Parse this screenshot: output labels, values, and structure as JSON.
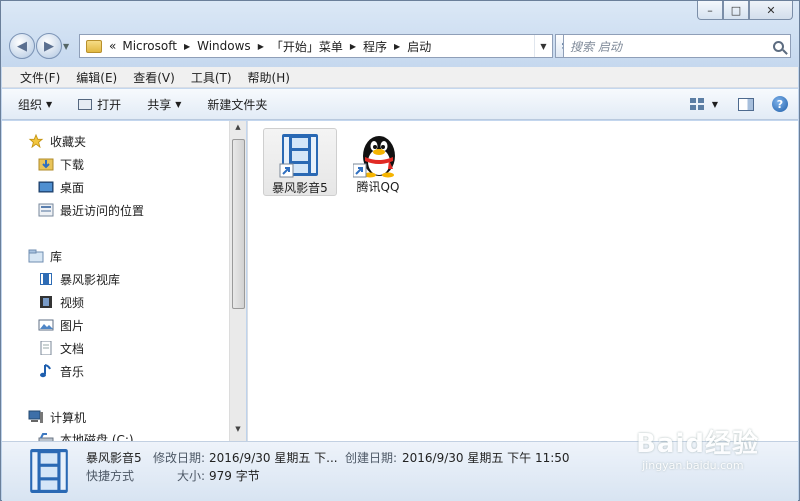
{
  "window": {
    "caption_buttons": {
      "minimize": "–",
      "maximize": "□",
      "close": "✕"
    }
  },
  "address": {
    "crumbs": [
      "«",
      "Microsoft",
      "Windows",
      "「开始」菜单",
      "程序",
      "启动"
    ],
    "search_placeholder": "搜索 启动"
  },
  "menu": [
    "文件(F)",
    "编辑(E)",
    "查看(V)",
    "工具(T)",
    "帮助(H)"
  ],
  "toolbar": {
    "organize": "组织",
    "open": "打开",
    "share": "共享",
    "new_folder": "新建文件夹"
  },
  "nav": {
    "favorites": {
      "label": "收藏夹",
      "items": [
        "下载",
        "桌面",
        "最近访问的位置"
      ]
    },
    "libraries": {
      "label": "库",
      "items": [
        "暴风影视库",
        "视频",
        "图片",
        "文档",
        "音乐"
      ]
    },
    "computer": {
      "label": "计算机",
      "items": [
        "本地磁盘 (C:)"
      ]
    }
  },
  "files": [
    {
      "name": "暴风影音5",
      "icon": "film-shortcut-icon",
      "selected": true
    },
    {
      "name": "腾讯QQ",
      "icon": "qq-penguin-icon",
      "selected": false
    }
  ],
  "details": {
    "name": "暴风影音5",
    "type": "快捷方式",
    "modified_label": "修改日期:",
    "modified_value": "2016/9/30 星期五 下...",
    "created_label": "创建日期:",
    "created_value": "2016/9/30 星期五 下午 11:50",
    "size_label": "大小:",
    "size_value": "979 字节"
  },
  "watermark": {
    "text": "Baid经验",
    "sub": "jingyan.baidu.com"
  },
  "colors": {
    "accent": "#3a73b8",
    "selection": "#e6e6e6"
  }
}
